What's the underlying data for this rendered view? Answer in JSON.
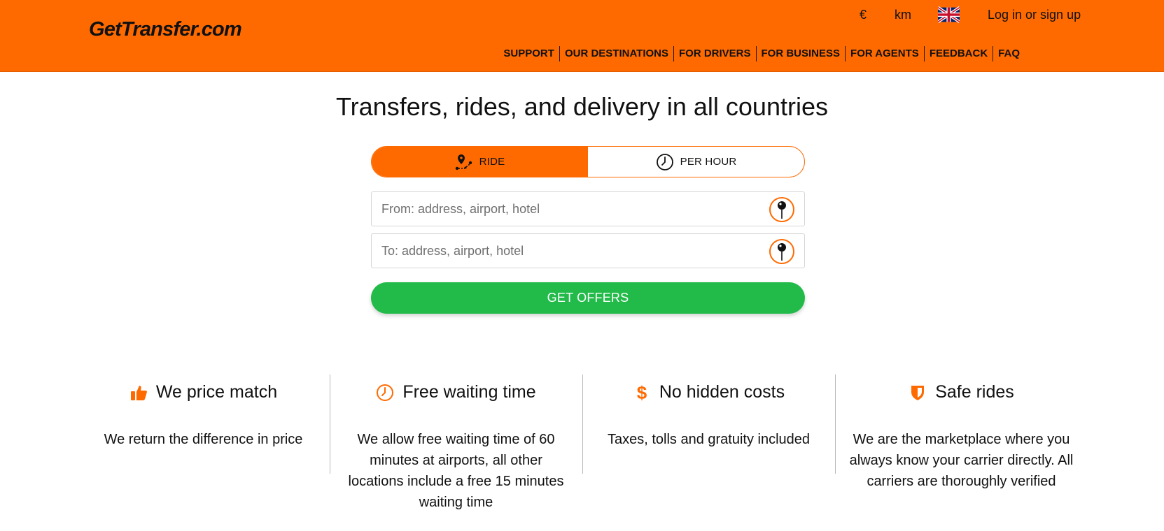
{
  "header": {
    "logo_text": "GetTransfer.com",
    "currency": "€",
    "units": "km",
    "language_flag_icon": "uk-flag-icon",
    "login_label": "Log in or sign up",
    "nav": [
      "SUPPORT",
      "OUR DESTINATIONS",
      "FOR DRIVERS",
      "FOR BUSINESS",
      "FOR AGENTS",
      "FEEDBACK",
      "FAQ"
    ]
  },
  "main": {
    "headline": "Transfers, rides, and delivery in all countries",
    "tabs": [
      {
        "label": "RIDE",
        "icon": "route-icon",
        "active": true
      },
      {
        "label": "PER HOUR",
        "icon": "clock-icon",
        "active": false
      }
    ],
    "from": {
      "placeholder": "From: address, airport, hotel",
      "value": "",
      "icon": "map-pin-icon"
    },
    "to": {
      "placeholder": "To: address, airport, hotel",
      "value": "",
      "icon": "map-pin-icon"
    },
    "submit_label": "GET OFFERS"
  },
  "features": [
    {
      "icon": "thumbs-up-icon",
      "title": "We price match",
      "desc": "We return the difference in price"
    },
    {
      "icon": "clock-icon",
      "title": "Free waiting time",
      "desc": "We allow free waiting time of 60 minutes at airports, all other locations include a free 15 minutes waiting time"
    },
    {
      "icon": "dollar-icon",
      "title": "No hidden costs",
      "desc": "Taxes, tolls and gratuity included"
    },
    {
      "icon": "shield-icon",
      "title": "Safe rides",
      "desc": "We are the marketplace where you always know your carrier directly. All carriers are thoroughly verified"
    }
  ],
  "colors": {
    "brand": "#ff6a00",
    "cta": "#22bb4a",
    "text": "#111111"
  }
}
